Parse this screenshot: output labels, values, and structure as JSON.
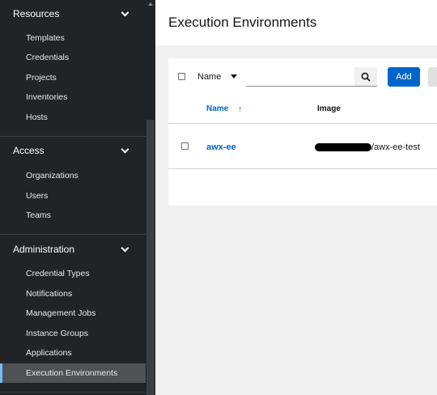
{
  "sidebar": {
    "groups": [
      {
        "title": "Resources",
        "items": [
          "Templates",
          "Credentials",
          "Projects",
          "Inventories",
          "Hosts"
        ]
      },
      {
        "title": "Access",
        "items": [
          "Organizations",
          "Users",
          "Teams"
        ]
      },
      {
        "title": "Administration",
        "items": [
          "Credential Types",
          "Notifications",
          "Management Jobs",
          "Instance Groups",
          "Applications",
          "Execution Environments"
        ]
      }
    ],
    "active_item": "Execution Environments"
  },
  "page": {
    "title": "Execution Environments"
  },
  "toolbar": {
    "filter_select": "Name",
    "search_value": "",
    "add_label": "Add"
  },
  "table": {
    "columns": [
      "Name",
      "Image"
    ],
    "sort_column": "Name",
    "sort_direction": "ascending",
    "rows": [
      {
        "name": "awx-ee",
        "image": "/awx-ee-test"
      }
    ]
  },
  "colors": {
    "sidebar_bg": "#212427",
    "link_blue": "#0066cc",
    "active_indicator": "#73bcf7"
  }
}
